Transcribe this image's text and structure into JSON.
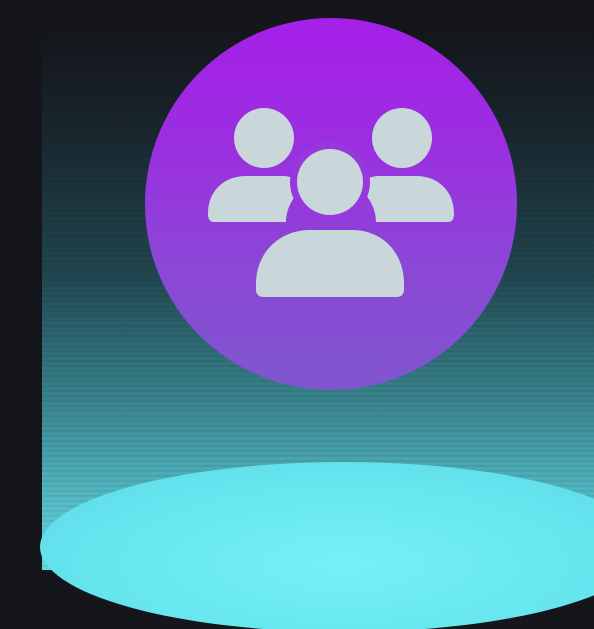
{
  "scene": {
    "icon": "user-group-icon",
    "colors": {
      "background": "#14161c",
      "badge_top": "#a61fe8",
      "badge_bottom": "#8056cf",
      "icon_fill": "#c9d6da",
      "beam_base": "#62d6e0",
      "platform": "#6ae8f2"
    }
  }
}
